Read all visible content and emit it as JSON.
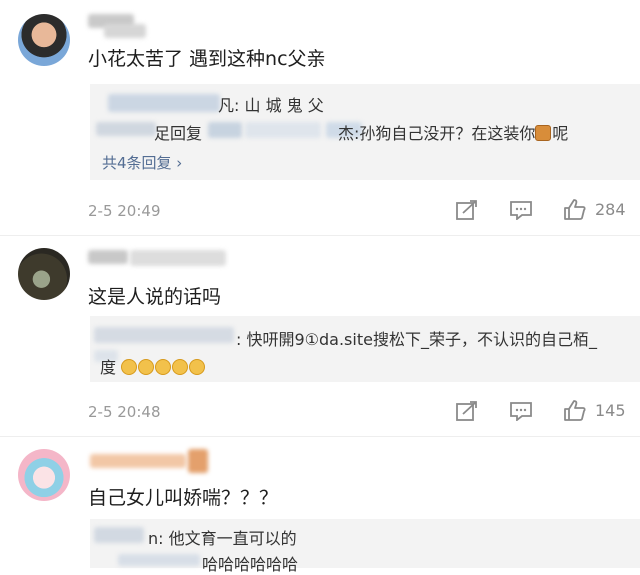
{
  "comments": [
    {
      "text": "小花太苦了 遇到这种nc父亲",
      "replies": [
        {
          "suffix": "凡: 山 城 鬼 父"
        },
        {
          "prefix": "足回复",
          "suffix": "杰:孙狗自己没开？在这装你",
          "tail": "呢"
        }
      ],
      "more_replies": "共4条回复 ›",
      "time": "2-5 20:49",
      "likes": "284"
    },
    {
      "text": "这是人说的话吗",
      "replies": [
        {
          "suffix": ": 快咞開9①da.site搜松下_荣子，不认识的自己栢_"
        },
        {
          "prefix": "度"
        }
      ],
      "time": "2-5 20:48",
      "likes": "145"
    },
    {
      "text": "自己女儿叫娇喘？？？",
      "replies": [
        {
          "suffix": "n: 他文育一直可以的"
        },
        {
          "suffix": "哈哈哈哈哈哈"
        }
      ]
    }
  ],
  "colors": {
    "link": "#536d93",
    "meta": "#999999",
    "reply_bg": "#f3f3f3"
  }
}
